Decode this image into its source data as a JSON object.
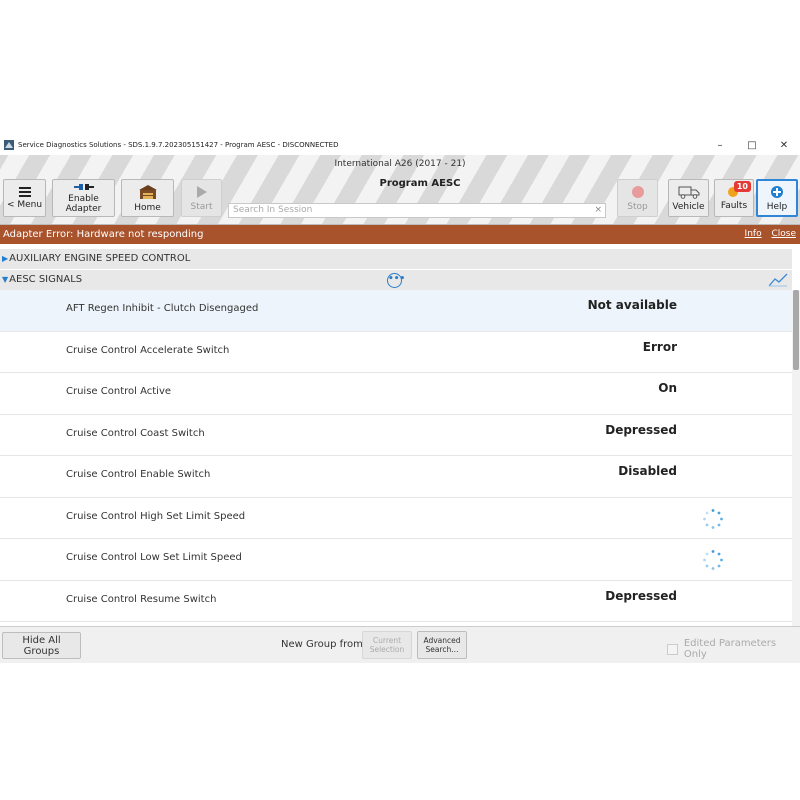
{
  "window": {
    "title": "Service Diagnostics Solutions - SDS.1.9.7.202305151427 - Program AESC - DISCONNECTED",
    "minimize": "–",
    "maximize": "□",
    "close": "✕"
  },
  "toolbar": {
    "menu_label": "< Menu",
    "enable_adapter_label_1": "Enable",
    "enable_adapter_label_2": "Adapter",
    "home_label": "Home",
    "start_label": "Start",
    "vehicle_line": "International A26 (2017 - 21)",
    "program_title": "Program AESC",
    "search_placeholder": "Search In Session",
    "search_clear": "×",
    "stop_label": "Stop",
    "vehicle_label": "Vehicle",
    "faults_label": "Faults",
    "faults_count": "10",
    "help_label": "Help"
  },
  "error_bar": {
    "message": "Adapter Error: Hardware not responding",
    "info_link": "Info",
    "close_link": "Close"
  },
  "groups": [
    {
      "title": "AUXILIARY ENGINE SPEED CONTROL",
      "expanded": false
    },
    {
      "title": "AESC SIGNALS",
      "expanded": true
    }
  ],
  "parameters": [
    {
      "name": "AFT Regen Inhibit - Clutch Disengaged",
      "value": "Not available",
      "loading": false,
      "selected": true
    },
    {
      "name": "Cruise Control Accelerate Switch",
      "value": "Error",
      "loading": false,
      "selected": false
    },
    {
      "name": "Cruise Control Active",
      "value": "On",
      "loading": false,
      "selected": false
    },
    {
      "name": "Cruise Control Coast Switch",
      "value": "Depressed",
      "loading": false,
      "selected": false
    },
    {
      "name": "Cruise Control Enable Switch",
      "value": "Disabled",
      "loading": false,
      "selected": false
    },
    {
      "name": "Cruise Control High Set Limit Speed",
      "value": "",
      "loading": true,
      "selected": false
    },
    {
      "name": "Cruise Control Low Set Limit Speed",
      "value": "",
      "loading": true,
      "selected": false
    },
    {
      "name": "Cruise Control Resume Switch",
      "value": "Depressed",
      "loading": false,
      "selected": false
    }
  ],
  "bottom": {
    "hide_groups_label": "Hide All Groups",
    "new_group_label": "New Group from:",
    "current_selection_1": "Current",
    "current_selection_2": "Selection",
    "advanced_search_1": "Advanced",
    "advanced_search_2": "Search...",
    "edited_only_label": "Edited Parameters Only"
  },
  "colors": {
    "error_bar": "#a9532d",
    "accent_blue": "#1f7fd1",
    "selected_row": "#edf4fb",
    "faults_badge": "#e53935"
  }
}
